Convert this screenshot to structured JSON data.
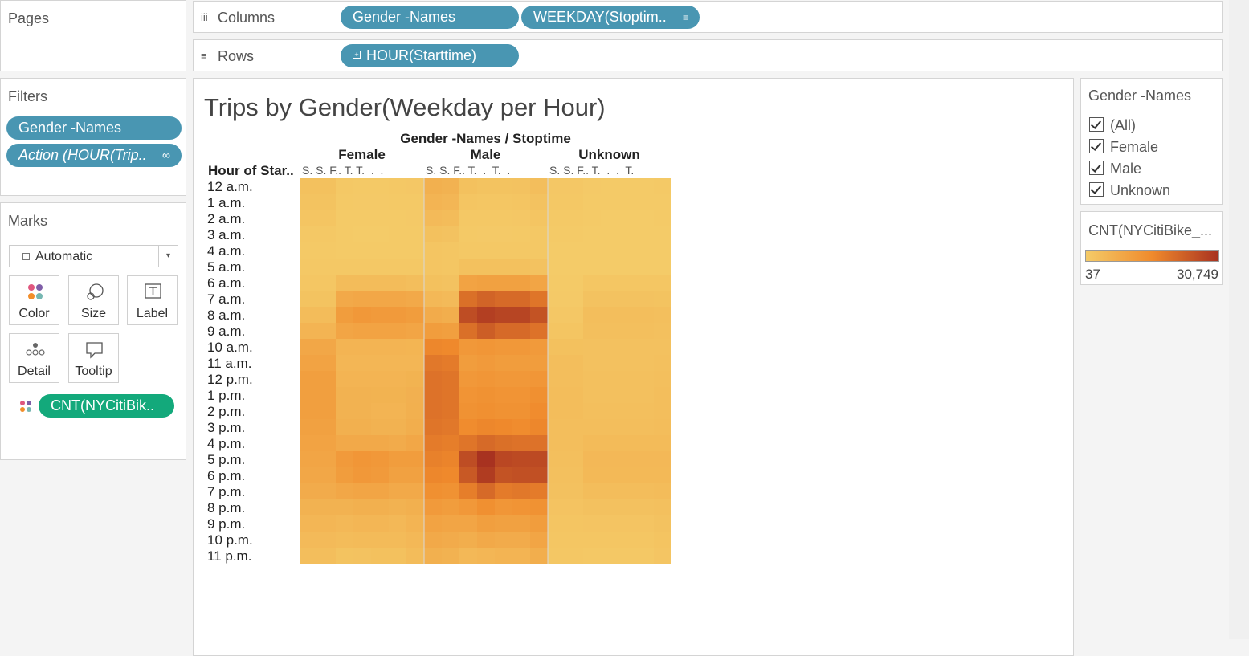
{
  "pages": {
    "title": "Pages"
  },
  "columns_shelf": {
    "label": "Columns",
    "icon": "iii",
    "pills": [
      "Gender -Names",
      "WEEKDAY(Stoptim.."
    ],
    "sort_icon": "sort-icon"
  },
  "rows_shelf": {
    "label": "Rows",
    "pills": [
      "HOUR(Starttime)"
    ]
  },
  "filters": {
    "title": "Filters",
    "pills": [
      "Gender -Names",
      "Action (HOUR(Trip.."
    ]
  },
  "marks": {
    "title": "Marks",
    "mark_type": "Automatic",
    "buttons": [
      "Color",
      "Size",
      "Label",
      "Detail",
      "Tooltip"
    ],
    "pill": "CNT(NYCitiBik.."
  },
  "viz": {
    "title": "Trips by Gender(Weekday per Hour)",
    "header_top": "Gender -Names / Stoptime",
    "row_header": "Hour of Star..",
    "groups": [
      {
        "name": "Female",
        "day_labels": "S. S. F.. T. T.  .  ."
      },
      {
        "name": "Male",
        "day_labels": "S. S. F.. T.  .  T.  ."
      },
      {
        "name": "Unknown",
        "day_labels": "S. S. F.. T.  .  .  T."
      }
    ],
    "hours": [
      "12 a.m.",
      "1 a.m.",
      "2 a.m.",
      "3 a.m.",
      "4 a.m.",
      "5 a.m.",
      "6 a.m.",
      "7 a.m.",
      "8 a.m.",
      "9 a.m.",
      "10 a.m.",
      "11 a.m.",
      "12 p.m.",
      "1 p.m.",
      "2 p.m.",
      "3 p.m.",
      "4 p.m.",
      "5 p.m.",
      "6 p.m.",
      "7 p.m.",
      "8 p.m.",
      "9 p.m.",
      "10 p.m.",
      "11 p.m."
    ]
  },
  "legend_filter": {
    "title": "Gender -Names",
    "options": [
      "(All)",
      "Female",
      "Male",
      "Unknown"
    ]
  },
  "color_legend": {
    "title": "CNT(NYCitiBike_...",
    "min": "37",
    "max": "30,749",
    "colors": [
      "#f4cb68",
      "#f08a2c",
      "#a83220"
    ]
  },
  "chart_data": {
    "type": "heatmap",
    "title": "Trips by Gender(Weekday per Hour)",
    "min": 37,
    "max": 30749,
    "rows": [
      "12 a.m.",
      "1 a.m.",
      "2 a.m.",
      "3 a.m.",
      "4 a.m.",
      "5 a.m.",
      "6 a.m.",
      "7 a.m.",
      "8 a.m.",
      "9 a.m.",
      "10 a.m.",
      "11 a.m.",
      "12 p.m.",
      "1 p.m.",
      "2 p.m.",
      "3 p.m.",
      "4 p.m.",
      "5 p.m.",
      "6 p.m.",
      "7 p.m.",
      "8 p.m.",
      "9 p.m.",
      "10 p.m.",
      "11 p.m."
    ],
    "column_groups": [
      "Female",
      "Male",
      "Unknown"
    ],
    "columns_per_group": 7,
    "values": {
      "Female": [
        [
          2500,
          2500,
          800,
          600,
          600,
          700,
          900
        ],
        [
          2000,
          2000,
          500,
          400,
          400,
          500,
          600
        ],
        [
          1500,
          1500,
          300,
          250,
          250,
          300,
          400
        ],
        [
          800,
          800,
          200,
          150,
          150,
          200,
          250
        ],
        [
          600,
          600,
          250,
          250,
          250,
          250,
          300
        ],
        [
          700,
          700,
          700,
          700,
          700,
          700,
          700
        ],
        [
          1200,
          1200,
          3500,
          3500,
          3500,
          3500,
          3200
        ],
        [
          2000,
          2000,
          8000,
          8500,
          8500,
          8500,
          8000
        ],
        [
          3500,
          3500,
          11000,
          12000,
          11500,
          11500,
          11000
        ],
        [
          5500,
          5500,
          9000,
          9500,
          9500,
          9500,
          9000
        ],
        [
          8500,
          8500,
          5500,
          5500,
          5500,
          5500,
          5300
        ],
        [
          9500,
          9500,
          5000,
          5000,
          5000,
          5000,
          5000
        ],
        [
          10500,
          10500,
          5500,
          5500,
          5500,
          5500,
          5800
        ],
        [
          10500,
          10500,
          6000,
          6000,
          5800,
          5800,
          6300
        ],
        [
          10500,
          10500,
          6000,
          6000,
          5500,
          5500,
          6500
        ],
        [
          10000,
          10000,
          6500,
          6500,
          6000,
          6000,
          7000
        ],
        [
          9500,
          9500,
          8000,
          8000,
          8000,
          7500,
          8500
        ],
        [
          9000,
          9000,
          11500,
          12500,
          12000,
          11000,
          11000
        ],
        [
          8500,
          8500,
          11000,
          12000,
          11500,
          10000,
          10000
        ],
        [
          7500,
          7500,
          8500,
          9000,
          9000,
          8000,
          8000
        ],
        [
          6000,
          6000,
          6000,
          6500,
          6500,
          6000,
          6500
        ],
        [
          5000,
          5000,
          4500,
          5000,
          5000,
          4500,
          5500
        ],
        [
          4000,
          4000,
          3500,
          3800,
          3800,
          3800,
          4500
        ],
        [
          3200,
          3200,
          2000,
          2200,
          2500,
          2500,
          3500
        ]
      ],
      "Male": [
        [
          6500,
          6000,
          2500,
          2000,
          2000,
          2200,
          3000
        ],
        [
          5500,
          5000,
          1500,
          1200,
          1200,
          1500,
          2200
        ],
        [
          4000,
          3500,
          800,
          700,
          700,
          900,
          1500
        ],
        [
          2500,
          2200,
          500,
          400,
          400,
          500,
          800
        ],
        [
          1500,
          1300,
          700,
          700,
          700,
          700,
          700
        ],
        [
          1500,
          1300,
          2500,
          2500,
          2500,
          2500,
          2200
        ],
        [
          2500,
          2200,
          9500,
          10000,
          10000,
          10000,
          9000
        ],
        [
          4500,
          4000,
          20000,
          22000,
          21000,
          21000,
          19000
        ],
        [
          7500,
          7000,
          26000,
          28500,
          27500,
          27500,
          25000
        ],
        [
          11000,
          10500,
          20000,
          23000,
          21000,
          21000,
          19500
        ],
        [
          16000,
          15500,
          12000,
          12500,
          12000,
          12000,
          11500
        ],
        [
          18500,
          18000,
          11000,
          11500,
          11000,
          11000,
          11000
        ],
        [
          19500,
          19000,
          12000,
          12500,
          12000,
          12000,
          12500
        ],
        [
          19500,
          19000,
          13000,
          13500,
          13000,
          13000,
          14000
        ],
        [
          19500,
          19000,
          13500,
          14000,
          13500,
          13500,
          15000
        ],
        [
          19000,
          18500,
          15000,
          16000,
          15500,
          15000,
          16000
        ],
        [
          18000,
          17500,
          19000,
          21000,
          20000,
          19500,
          19500
        ],
        [
          17000,
          16500,
          26000,
          30749,
          27000,
          26500,
          26500
        ],
        [
          16000,
          15500,
          24000,
          29000,
          25000,
          25500,
          25500
        ],
        [
          14000,
          13500,
          17500,
          21000,
          18000,
          18500,
          18000
        ],
        [
          11500,
          11000,
          12000,
          14000,
          12500,
          13000,
          13500
        ],
        [
          9500,
          9000,
          9000,
          10500,
          10000,
          10000,
          11000
        ],
        [
          8000,
          7500,
          7000,
          8000,
          7500,
          7500,
          9000
        ],
        [
          6500,
          6000,
          4500,
          5000,
          5500,
          5500,
          7000
        ]
      ],
      "Unknown": [
        [
          900,
          900,
          400,
          350,
          350,
          350,
          450
        ],
        [
          700,
          700,
          300,
          250,
          250,
          250,
          350
        ],
        [
          500,
          500,
          200,
          150,
          150,
          150,
          250
        ],
        [
          300,
          300,
          100,
          80,
          80,
          80,
          150
        ],
        [
          150,
          150,
          60,
          50,
          50,
          50,
          80
        ],
        [
          100,
          100,
          150,
          150,
          150,
          150,
          150
        ],
        [
          200,
          200,
          1300,
          1300,
          1300,
          1300,
          1200
        ],
        [
          400,
          400,
          2200,
          2200,
          2200,
          2200,
          2000
        ],
        [
          900,
          900,
          3000,
          3000,
          3000,
          3000,
          2800
        ],
        [
          1500,
          1500,
          2800,
          2800,
          2800,
          2800,
          2600
        ],
        [
          2500,
          2500,
          2300,
          2300,
          2300,
          2300,
          2300
        ],
        [
          3000,
          3000,
          2400,
          2400,
          2400,
          2400,
          2600
        ],
        [
          3200,
          3200,
          2600,
          2600,
          2600,
          2600,
          2900
        ],
        [
          3300,
          3300,
          2700,
          2700,
          2700,
          2700,
          3000
        ],
        [
          3300,
          3300,
          2800,
          2800,
          2800,
          2800,
          3100
        ],
        [
          3200,
          3200,
          3000,
          3000,
          3000,
          3000,
          3300
        ],
        [
          3000,
          3000,
          3800,
          3800,
          3800,
          3800,
          3900
        ],
        [
          2800,
          2800,
          4500,
          4500,
          4500,
          4500,
          4500
        ],
        [
          2600,
          2600,
          4300,
          4300,
          4300,
          4300,
          4300
        ],
        [
          2300,
          2300,
          3300,
          3300,
          3300,
          3300,
          3500
        ],
        [
          1900,
          1900,
          2300,
          2300,
          2300,
          2300,
          2700
        ],
        [
          1500,
          1500,
          1700,
          1700,
          1700,
          1700,
          2100
        ],
        [
          1200,
          1200,
          1200,
          1200,
          1200,
          1200,
          1800
        ],
        [
          1000,
          1000,
          800,
          800,
          800,
          800,
          1400
        ]
      ]
    }
  }
}
